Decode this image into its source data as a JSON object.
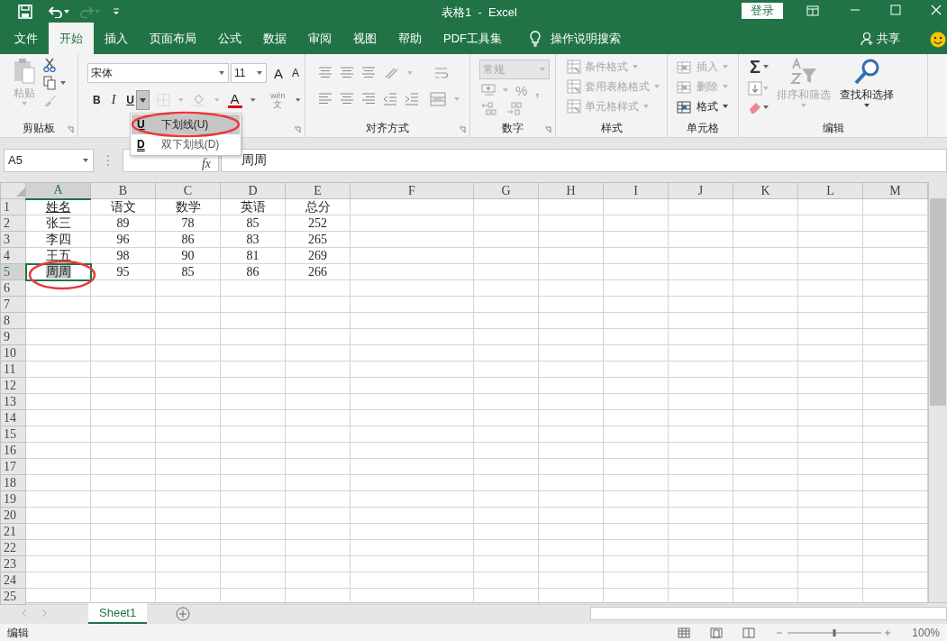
{
  "title_bar": {
    "title": "表格1  -  Excel",
    "sign_in": "登录"
  },
  "menu_tabs": [
    {
      "label": "文件",
      "selected": false
    },
    {
      "label": "开始",
      "selected": true
    },
    {
      "label": "插入",
      "selected": false
    },
    {
      "label": "页面布局",
      "selected": false
    },
    {
      "label": "公式",
      "selected": false
    },
    {
      "label": "数据",
      "selected": false
    },
    {
      "label": "审阅",
      "selected": false
    },
    {
      "label": "视图",
      "selected": false
    },
    {
      "label": "帮助",
      "selected": false
    },
    {
      "label": "PDF工具集",
      "selected": false
    }
  ],
  "tell_me": "操作说明搜索",
  "share": "共享",
  "ribbon": {
    "clipboard": {
      "paste": "粘贴",
      "paste_disabled": true,
      "group": "剪贴板"
    },
    "font": {
      "name": "宋体",
      "size": "11",
      "grow": "A",
      "shrink": "A",
      "bold": "B",
      "italic": "I",
      "underline": "U",
      "color_letter": "A",
      "phonetic_top": "wén",
      "phonetic_bottom": "文",
      "underline_menu_open": true
    },
    "alignment": {
      "group": "对齐方式"
    },
    "number": {
      "format": "常规",
      "percent": "%",
      "comma": ",",
      "disabled": true,
      "group": "数字"
    },
    "styles": {
      "items": [
        {
          "label": "条件格式",
          "disabled": true
        },
        {
          "label": "套用表格格式",
          "disabled": true
        },
        {
          "label": "单元格样式",
          "disabled": true
        }
      ],
      "group": "样式"
    },
    "cells": {
      "items": [
        {
          "label": "插入",
          "disabled": true
        },
        {
          "label": "删除",
          "disabled": true
        },
        {
          "label": "格式",
          "disabled": false
        }
      ],
      "group": "单元格"
    },
    "editing": {
      "sum": "Σ",
      "sort": {
        "label": "排序和筛选",
        "disabled": true
      },
      "find": {
        "label": "查找和选择",
        "disabled": false
      },
      "group": "编辑"
    }
  },
  "underline_menu": [
    {
      "key": "U",
      "label": "下划线(U)",
      "selected": true,
      "circled": true
    },
    {
      "key": "D",
      "label": "双下划线(D)",
      "selected": false,
      "circled": false
    }
  ],
  "formula_bar": {
    "name_box": "A5",
    "fx": "fx",
    "value": "周周"
  },
  "sheet": {
    "columns": [
      {
        "label": "A",
        "selected": true
      },
      {
        "label": "B",
        "selected": false
      },
      {
        "label": "C",
        "selected": false
      },
      {
        "label": "D",
        "selected": false
      },
      {
        "label": "E",
        "selected": false
      },
      {
        "label": "F",
        "selected": false
      },
      {
        "label": "G",
        "selected": false
      },
      {
        "label": "H",
        "selected": false
      },
      {
        "label": "I",
        "selected": false
      },
      {
        "label": "J",
        "selected": false
      },
      {
        "label": "K",
        "selected": false
      },
      {
        "label": "L",
        "selected": false
      },
      {
        "label": "M",
        "selected": false
      }
    ],
    "rows": [
      {
        "label": "1",
        "selected": false,
        "cells": [
          {
            "text": "姓名",
            "underline": true
          },
          {
            "text": "语文"
          },
          {
            "text": "数学"
          },
          {
            "text": "英语"
          },
          {
            "text": "总分"
          }
        ]
      },
      {
        "label": "2",
        "selected": false,
        "cells": [
          {
            "text": "张三"
          },
          {
            "text": "89"
          },
          {
            "text": "78"
          },
          {
            "text": "85"
          },
          {
            "text": "252"
          }
        ]
      },
      {
        "label": "3",
        "selected": false,
        "cells": [
          {
            "text": "李四"
          },
          {
            "text": "96"
          },
          {
            "text": "86"
          },
          {
            "text": "83"
          },
          {
            "text": "265"
          }
        ]
      },
      {
        "label": "4",
        "selected": false,
        "cells": [
          {
            "text": "王五"
          },
          {
            "text": "98"
          },
          {
            "text": "90"
          },
          {
            "text": "81"
          },
          {
            "text": "269"
          }
        ]
      },
      {
        "label": "5",
        "selected": true,
        "cells": [
          {
            "text": "周周",
            "selected": true,
            "circled": true
          },
          {
            "text": "95"
          },
          {
            "text": "85"
          },
          {
            "text": "86"
          },
          {
            "text": "266"
          }
        ]
      },
      {
        "label": "6",
        "selected": false
      },
      {
        "label": "7",
        "selected": false
      },
      {
        "label": "8",
        "selected": false
      },
      {
        "label": "9",
        "selected": false
      },
      {
        "label": "10",
        "selected": false
      },
      {
        "label": "11",
        "selected": false
      },
      {
        "label": "12",
        "selected": false
      },
      {
        "label": "13",
        "selected": false
      },
      {
        "label": "14",
        "selected": false
      },
      {
        "label": "15",
        "selected": false
      },
      {
        "label": "16",
        "selected": false
      },
      {
        "label": "17",
        "selected": false
      },
      {
        "label": "18",
        "selected": false
      },
      {
        "label": "19",
        "selected": false
      },
      {
        "label": "20",
        "selected": false
      },
      {
        "label": "21",
        "selected": false
      },
      {
        "label": "22",
        "selected": false
      },
      {
        "label": "23",
        "selected": false
      },
      {
        "label": "24",
        "selected": false
      },
      {
        "label": "25",
        "selected": false
      }
    ]
  },
  "sheet_tabs": [
    {
      "label": "Sheet1",
      "selected": true
    }
  ],
  "status_bar": {
    "mode": "编辑",
    "zoom_slider": {
      "level": 0.5
    },
    "zoom": "100%"
  }
}
